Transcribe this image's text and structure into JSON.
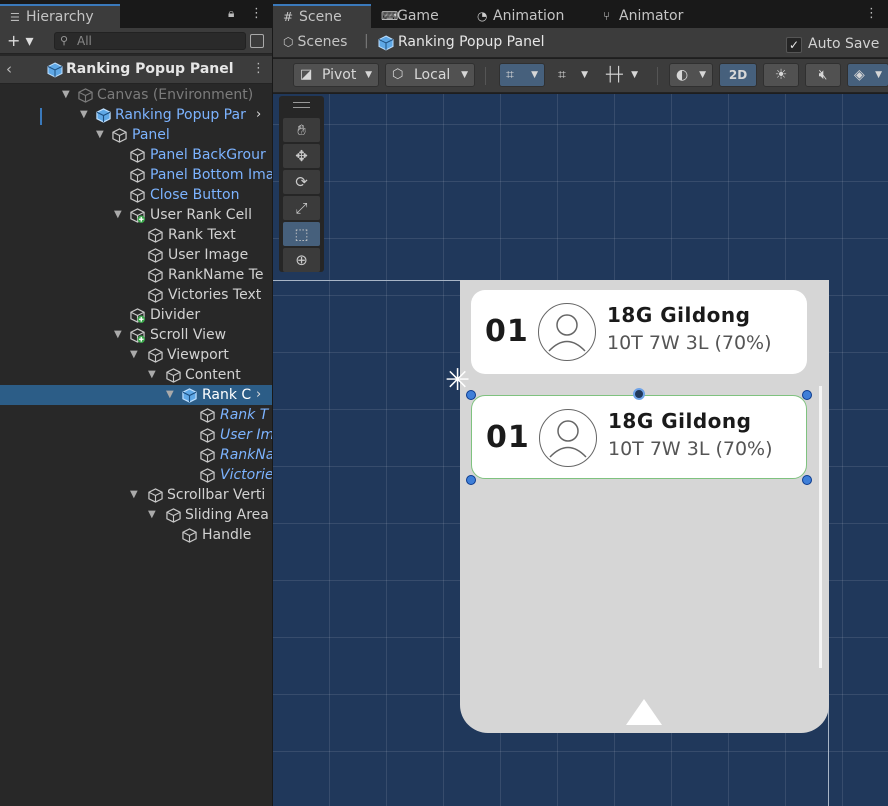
{
  "hierarchy": {
    "tab_label": "Hierarchy",
    "search_placeholder": "All",
    "breadcrumb_title": "Ranking Popup Panel",
    "rows": [
      {
        "label": "Canvas (Environment)"
      },
      {
        "label": "Ranking Popup Par"
      },
      {
        "label": "Panel"
      },
      {
        "label": "Panel BackGrour"
      },
      {
        "label": "Panel Bottom Ima"
      },
      {
        "label": "Close Button"
      },
      {
        "label": "User Rank Cell"
      },
      {
        "label": "Rank Text"
      },
      {
        "label": "User Image"
      },
      {
        "label": "RankName Te"
      },
      {
        "label": "Victories Text"
      },
      {
        "label": "Divider"
      },
      {
        "label": "Scroll View"
      },
      {
        "label": "Viewport"
      },
      {
        "label": "Content"
      },
      {
        "label": "Rank C"
      },
      {
        "label": "Rank T"
      },
      {
        "label": "User Im"
      },
      {
        "label": "RankNa"
      },
      {
        "label": "Victorie"
      },
      {
        "label": "Scrollbar Verti"
      },
      {
        "label": "Sliding Area"
      },
      {
        "label": "Handle"
      }
    ]
  },
  "editor": {
    "tabs": [
      {
        "label": "Scene"
      },
      {
        "label": "Game"
      },
      {
        "label": "Animation"
      },
      {
        "label": "Animator"
      }
    ],
    "scenes_label": "Scenes",
    "prefab_title": "Ranking Popup Panel",
    "auto_save_label": "Auto Save",
    "auto_save_checked": true,
    "toolbar": {
      "pivot_label": "Pivot",
      "local_label": "Local",
      "mode_2d_label": "2D"
    }
  },
  "scene_content": {
    "cells": [
      {
        "rank": "01",
        "name": "18G Gildong",
        "victories": "10T 7W 3L (70%)"
      },
      {
        "rank": "01",
        "name": "18G Gildong",
        "victories": "10T 7W 3L (70%)"
      }
    ]
  },
  "colors": {
    "selection": "#2c5d87",
    "scene_bg": "#20385b",
    "accent": "#3a79bb",
    "prefab_blue": "#7cb3ff"
  }
}
